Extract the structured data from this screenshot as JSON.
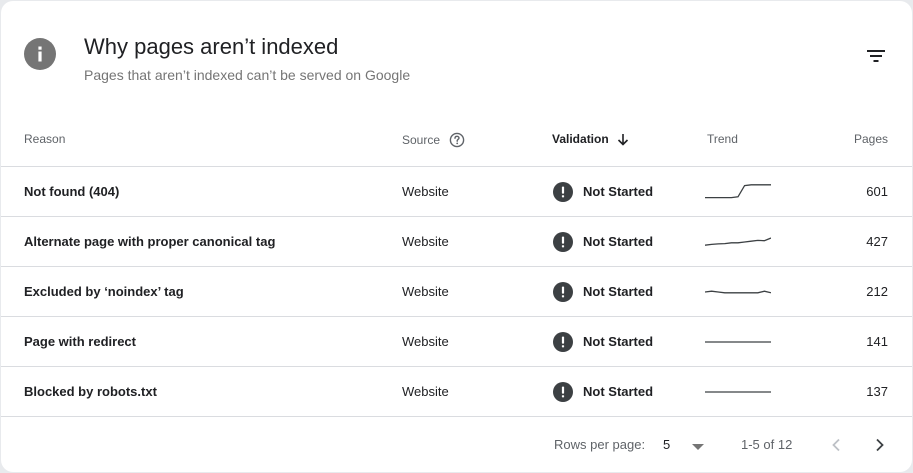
{
  "header": {
    "title": "Why pages aren’t indexed",
    "subtitle": "Pages that aren’t indexed can’t be served on Google",
    "icon": "info-icon",
    "filter_icon": "filter-icon"
  },
  "columns": {
    "reason": "Reason",
    "source": "Source",
    "validation": "Validation",
    "trend": "Trend",
    "pages": "Pages"
  },
  "rows": [
    {
      "reason": "Not found (404)",
      "source": "Website",
      "validation": "Not Started",
      "pages": "601",
      "trend": [
        0.15,
        0.15,
        0.15,
        0.15,
        0.15,
        0.2,
        0.9,
        0.95,
        0.95,
        0.95,
        0.95
      ]
    },
    {
      "reason": "Alternate page with proper canonical tag",
      "source": "Website",
      "validation": "Not Started",
      "pages": "427",
      "trend": [
        0.3,
        0.35,
        0.38,
        0.4,
        0.45,
        0.45,
        0.5,
        0.55,
        0.6,
        0.58,
        0.75
      ]
    },
    {
      "reason": "Excluded by ‘noindex’ tag",
      "source": "Website",
      "validation": "Not Started",
      "pages": "212",
      "trend": [
        0.5,
        0.55,
        0.5,
        0.45,
        0.45,
        0.45,
        0.45,
        0.45,
        0.45,
        0.55,
        0.45
      ]
    },
    {
      "reason": "Page with redirect",
      "source": "Website",
      "validation": "Not Started",
      "pages": "141",
      "trend": [
        0.5,
        0.5,
        0.5,
        0.5,
        0.5,
        0.5,
        0.5,
        0.5,
        0.5,
        0.5,
        0.5
      ]
    },
    {
      "reason": "Blocked by robots.txt",
      "source": "Website",
      "validation": "Not Started",
      "pages": "137",
      "trend": [
        0.5,
        0.5,
        0.5,
        0.5,
        0.5,
        0.5,
        0.5,
        0.5,
        0.5,
        0.5,
        0.5
      ]
    }
  ],
  "footer": {
    "rows_per_page_label": "Rows per page:",
    "rows_per_page_value": "5",
    "range": "1-5 of 12"
  },
  "colors": {
    "validation_icon": "#3c4043",
    "info_icon": "#757575",
    "divider": "#dadce0",
    "sparkline": "#3c4043"
  }
}
